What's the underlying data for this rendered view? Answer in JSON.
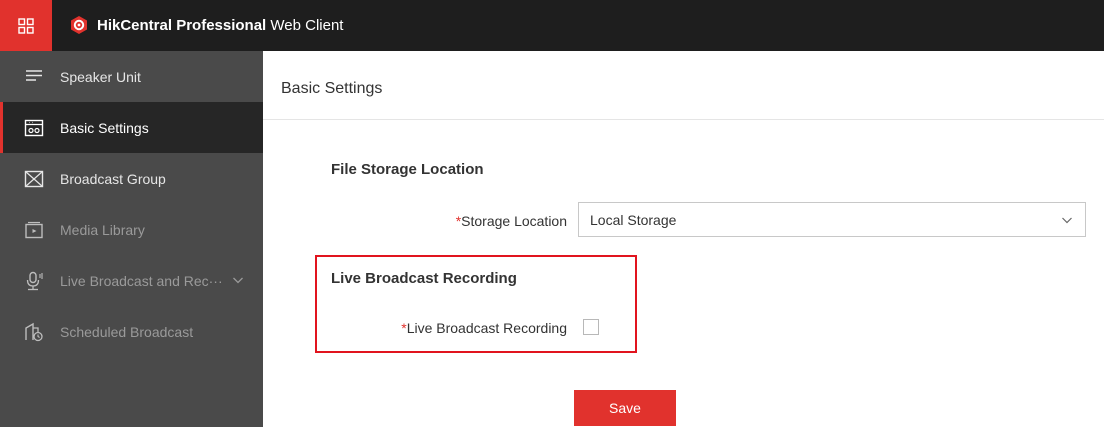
{
  "header": {
    "brand_bold": "HikCentral Professional",
    "brand_rest": " Web Client"
  },
  "sidebar": {
    "title": "Speaker Unit",
    "items": [
      {
        "label": "Basic Settings",
        "icon": "settings-panel-icon",
        "state": "active"
      },
      {
        "label": "Broadcast Group",
        "icon": "broadcast-group-icon",
        "state": "enabled"
      },
      {
        "label": "Media Library",
        "icon": "media-library-icon",
        "state": "disabled"
      },
      {
        "label": "Live Broadcast and Rec···",
        "icon": "microphone-icon",
        "state": "disabled"
      },
      {
        "label": "Scheduled Broadcast",
        "icon": "scheduled-broadcast-icon",
        "state": "disabled"
      }
    ]
  },
  "main": {
    "page_title": "Basic Settings",
    "file_storage": {
      "title": "File Storage Location",
      "required_mark": "*",
      "storage_label": "Storage Location",
      "storage_value": "Local Storage"
    },
    "live_recording": {
      "title": "Live Broadcast Recording",
      "required_mark": "*",
      "checkbox_label": "Live Broadcast Recording",
      "checked": false
    },
    "save_label": "Save"
  },
  "colors": {
    "accent": "#e1322d",
    "topbar": "#1e1e1e",
    "sidebar": "#4a4a4a",
    "sidebar_active": "#262626",
    "highlight": "#e1141e"
  }
}
